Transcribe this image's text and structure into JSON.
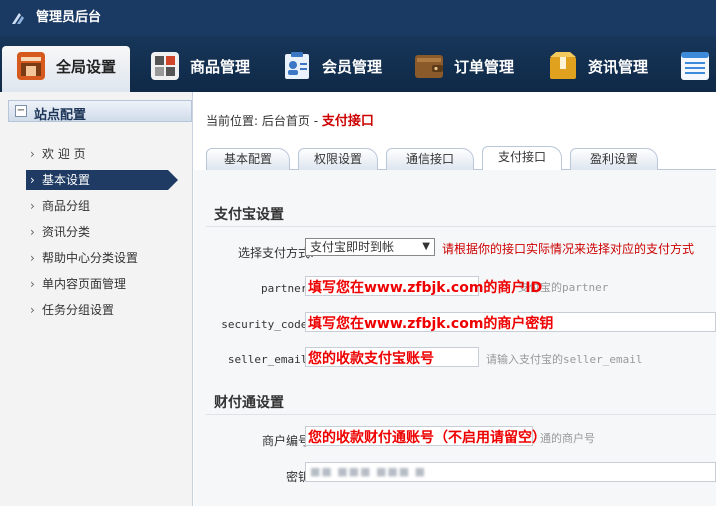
{
  "titlebar": {
    "title": "管理员后台",
    "logo_icon": "app-logo-icon"
  },
  "mainnav": {
    "items": [
      {
        "label": "全局设置",
        "icon": "settings-box-icon",
        "active": true
      },
      {
        "label": "商品管理",
        "icon": "grid-icon"
      },
      {
        "label": "会员管理",
        "icon": "member-card-icon"
      },
      {
        "label": "订单管理",
        "icon": "wallet-icon"
      },
      {
        "label": "资讯管理",
        "icon": "package-icon"
      },
      {
        "label": "",
        "icon": "list-doc-icon"
      }
    ]
  },
  "sidebar": {
    "header": "站点配置",
    "items": [
      {
        "label": "欢 迎 页"
      },
      {
        "label": "基本设置",
        "active": true
      },
      {
        "label": "商品分组"
      },
      {
        "label": "资讯分类"
      },
      {
        "label": "帮助中心分类设置"
      },
      {
        "label": "单内容页面管理"
      },
      {
        "label": "任务分组设置"
      }
    ]
  },
  "breadcrumb": {
    "prefix": "当前位置: 首页",
    "home": "后台首页",
    "sep": "-",
    "current": "支付接口"
  },
  "tabs": [
    {
      "label": "基本配置"
    },
    {
      "label": "权限设置"
    },
    {
      "label": "通信接口"
    },
    {
      "label": "支付接口",
      "active": true
    },
    {
      "label": "盈利设置"
    }
  ],
  "alipay": {
    "title": "支付宝设置",
    "method_label": "选择支付方式:",
    "method_value": "支付宝即时到帐",
    "method_hint": "请根据你的接口实际情况来选择对应的支付方式",
    "partner_label": "partner:",
    "partner_hint": "支付宝的partner",
    "partner_overlay": "填写您在www.zfbjk.com的商户ID",
    "security_label": "security_code:",
    "security_overlay": "填写您在www.zfbjk.com的商户密钥",
    "email_label": "seller_email:",
    "email_hint": "请输入支付宝的seller_email",
    "email_overlay": "您的收款支付宝账号"
  },
  "tenpay": {
    "title": "财付通设置",
    "merchant_label": "商户编号:",
    "merchant_hint": "通的商户号",
    "merchant_overlay": "您的收款财付通账号（不启用请留空）",
    "key_label": "密钥:",
    "key_value": "■■ ■■■ ■■■ ■"
  },
  "colors": {
    "nav_bg": "#1b3a63",
    "accent_red": "#cc0000",
    "sidebar_active": "#1f3b63"
  }
}
